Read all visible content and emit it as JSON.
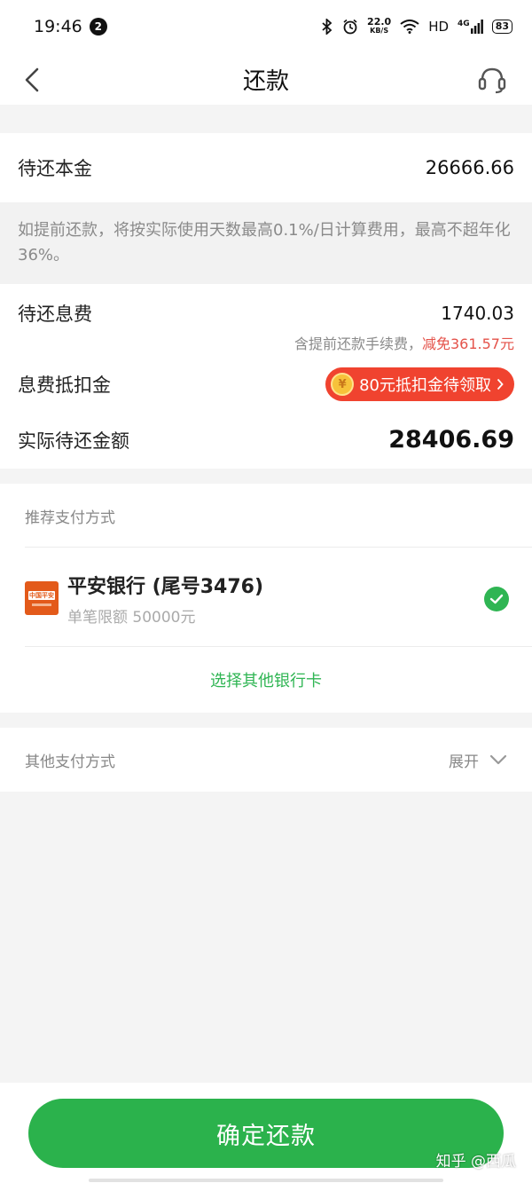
{
  "status_bar": {
    "time": "19:46",
    "notification_count": "2",
    "net_speed_value": "22.0",
    "net_speed_unit": "KB/S",
    "hd_label": "HD",
    "cell_label": "4G",
    "battery": "83"
  },
  "nav": {
    "title": "还款"
  },
  "principal": {
    "label": "待还本金",
    "value": "26666.66"
  },
  "notice": {
    "text": "如提前还款，将按实际使用天数最高0.1%/日计算费用，最高不超年化36%。"
  },
  "fees": {
    "interest_label": "待还息费",
    "interest_value": "1740.03",
    "fee_note_prefix": "含提前还款手续费，",
    "fee_note_discount": "减免361.57元",
    "coupon_label": "息费抵扣金",
    "coupon_coin": "¥",
    "coupon_text": "80元抵扣金待领取",
    "actual_label": "实际待还金额",
    "actual_value": "28406.69"
  },
  "payment": {
    "recommended_header": "推荐支付方式",
    "bank_logo_text": "中国平安",
    "bank_name": "平安银行 (尾号3476)",
    "bank_limit": "单笔限额 50000元",
    "select_other_link": "选择其他银行卡",
    "other_methods_label": "其他支付方式",
    "expand_label": "展开"
  },
  "footer": {
    "confirm_label": "确定还款",
    "watermark": "知乎 @西瓜"
  },
  "colors": {
    "brand_green": "#2bb24c",
    "coupon_red": "#f0432f",
    "discount_red": "#e4524a",
    "bank_orange": "#e35a1a"
  }
}
